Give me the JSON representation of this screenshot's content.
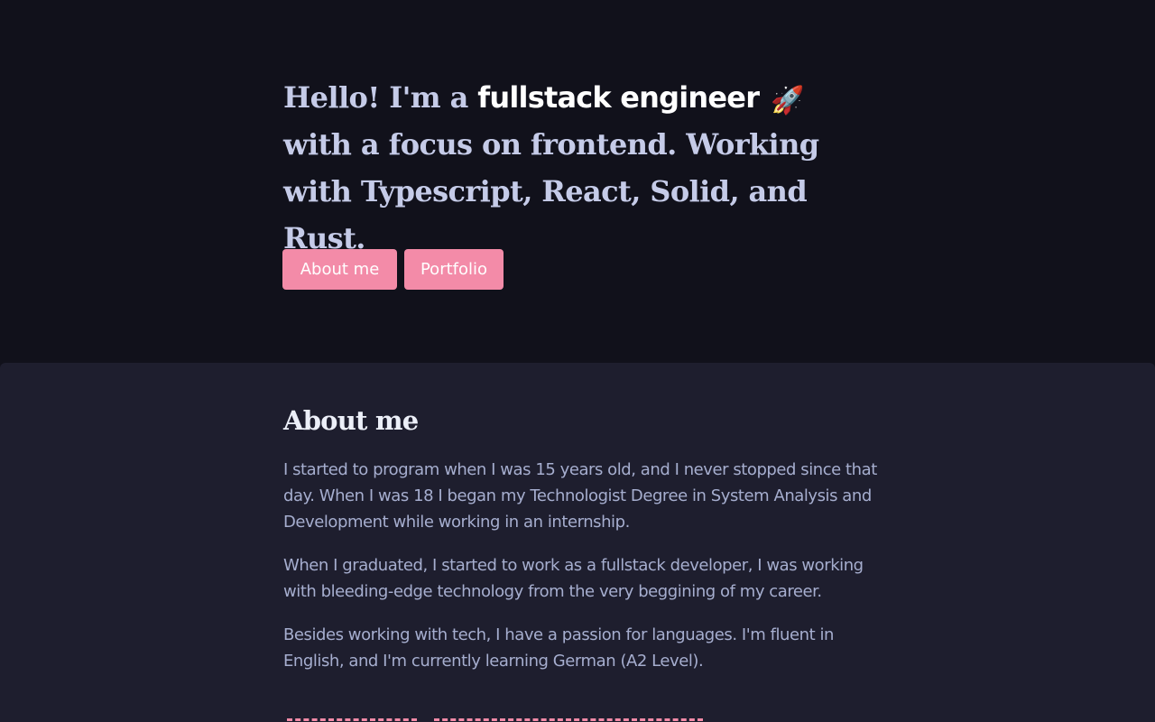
{
  "hero": {
    "headline_before": "Hello! I'm a ",
    "headline_highlight": "fullstack engineer",
    "rocket_emoji": "🚀",
    "headline_after": " with a focus on frontend. Working with Typescript, React, Solid, and Rust.",
    "buttons": {
      "about_label": "About me",
      "portfolio_label": "Portfolio"
    }
  },
  "about": {
    "title": "About me",
    "paragraphs": [
      "I started to program when I was 15 years old, and I never stopped since that day. When I was 18 I began my Technologist Degree in System Analysis and Development while working in an internship.",
      "When I graduated, I started to work as a fullstack developer, I was working with bleeding-edge technology from the very beggining of my career.",
      "Besides working with tech, I have a passion for languages. I'm fluent in English, and I'm currently learning German (A2 Level)."
    ]
  },
  "colors": {
    "page_background": "#11111b",
    "section_background": "#1e1e2e",
    "accent": "#f38ba8",
    "text": "#a6aecf",
    "heading": "#c5cbe8"
  }
}
